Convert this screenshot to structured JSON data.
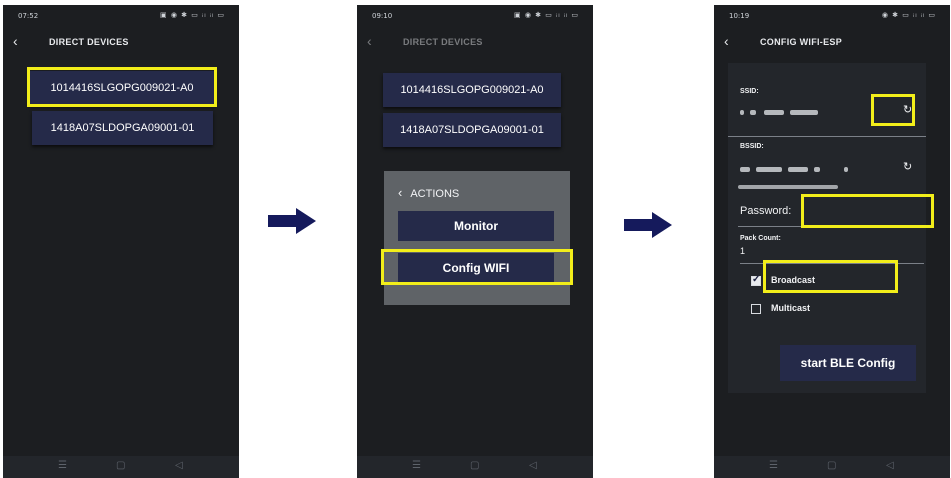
{
  "screens": [
    {
      "status_time": "07:52",
      "status_icons": "▣ ◉ ✱ ▭ ᵢₗ ᵢₗ ▭",
      "nav_title": "DIRECT DEVICES",
      "devices": [
        "1014416SLGOPG009021-A0",
        "1418A07SLDOPGA09001-01"
      ]
    },
    {
      "status_time": "09:10",
      "status_icons": "▣ ◉ ✱ ▭ ᵢₗ ᵢₗ ▭",
      "nav_title": "DIRECT DEVICES",
      "devices": [
        "1014416SLGOPG009021-A0",
        "1418A07SLDOPGA09001-01"
      ],
      "actions": {
        "title": "ACTIONS",
        "monitor": "Monitor",
        "config_wifi": "Config WIFI"
      }
    },
    {
      "status_time": "10:19",
      "status_icons": "◉ ✱ ▭ ᵢₗ ᵢₗ ▭",
      "nav_title": "CONFIG WIFI-ESP",
      "ssid_label": "SSID:",
      "bssid_label": "BSSID:",
      "password_label": "Password:",
      "pack_count_label": "Pack Count:",
      "pack_count_value": "1",
      "broadcast_label": "Broadcast",
      "broadcast_checked": true,
      "multicast_label": "Multicast",
      "multicast_checked": false,
      "start_button": "start BLE Config"
    }
  ],
  "nav_icons": [
    "menu-icon",
    "home-icon",
    "back-icon"
  ],
  "colors": {
    "highlight": "#f2ee1a",
    "button_bg": "#252a49",
    "arrow": "#151a5c",
    "screen_bg": "#1c1e21"
  }
}
